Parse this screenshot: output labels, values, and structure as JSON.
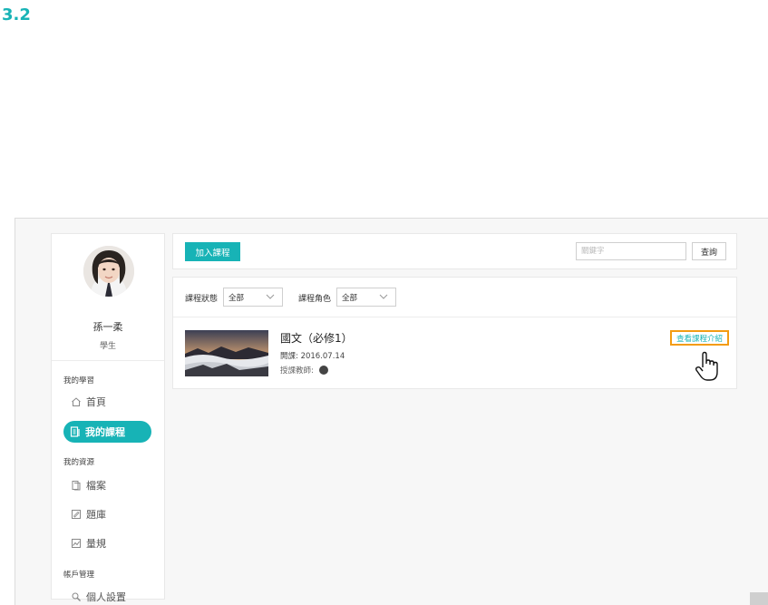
{
  "step": "3.2",
  "user": {
    "name": "孫一柔",
    "role": "學生"
  },
  "sidebar": {
    "sections": [
      {
        "title": "我的學習"
      },
      {
        "title": "我的資源"
      },
      {
        "title": "帳戶管理"
      }
    ],
    "items": [
      {
        "label": "首頁",
        "icon": "home-icon"
      },
      {
        "label": "我的課程",
        "icon": "course-icon",
        "active": true
      },
      {
        "label": "檔案",
        "icon": "file-icon"
      },
      {
        "label": "題庫",
        "icon": "question-bank-icon"
      },
      {
        "label": "量規",
        "icon": "rubric-icon"
      },
      {
        "label": "個人設置",
        "icon": "settings-icon"
      }
    ]
  },
  "toolbar": {
    "add_label": "加入課程",
    "search_placeholder": "關鍵字",
    "query_label": "查詢"
  },
  "filters": {
    "status_label": "課程狀態",
    "status_value": "全部",
    "role_label": "課程角色",
    "role_value": "全部"
  },
  "course": {
    "title": "國文（必修1）",
    "date": "開課: 2016.07.14",
    "teacher_label": "授課教師:",
    "view_label": "查看課程介紹"
  },
  "colors": {
    "accent": "#17b3b6",
    "highlight": "#f39c12"
  }
}
